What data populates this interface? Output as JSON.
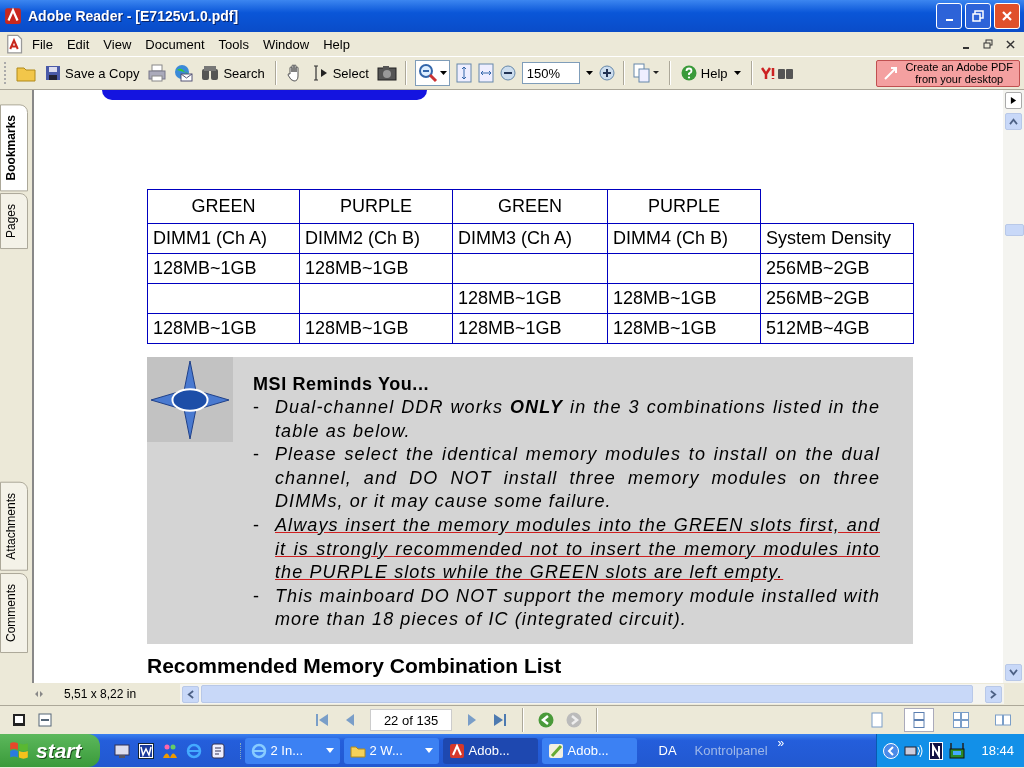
{
  "window": {
    "title": "Adobe Reader - [E7125v1.0.pdf]"
  },
  "menu": [
    "File",
    "Edit",
    "View",
    "Document",
    "Tools",
    "Window",
    "Help"
  ],
  "toolbar": {
    "save_label": "Save a Copy",
    "search_label": "Search",
    "select_label": "Select",
    "zoom": "150%",
    "help_label": "Help",
    "promo_lines": [
      "Create an Adobe PDF",
      "from your desktop"
    ]
  },
  "side_tabs": [
    {
      "label": "Bookmarks",
      "selected": true
    },
    {
      "label": "Pages",
      "selected": false
    },
    {
      "label": "Attachments",
      "selected": false
    },
    {
      "label": "Comments",
      "selected": false
    }
  ],
  "document": {
    "table": {
      "header": [
        "GREEN",
        "PURPLE",
        "GREEN",
        "PURPLE"
      ],
      "columns": [
        "DIMM1 (Ch A)",
        "DIMM2 (Ch B)",
        "DIMM3 (Ch A)",
        "DIMM4 (Ch B)",
        "System Density"
      ],
      "rows": [
        [
          "128MB~1GB",
          "128MB~1GB",
          "",
          "",
          "256MB~2GB"
        ],
        [
          "",
          "",
          "128MB~1GB",
          "128MB~1GB",
          "256MB~2GB"
        ],
        [
          "128MB~1GB",
          "128MB~1GB",
          "128MB~1GB",
          "128MB~1GB",
          "512MB~4GB"
        ]
      ]
    },
    "notice": {
      "title": "MSI Reminds You...",
      "bullets": [
        {
          "marker": "-",
          "text": "Dual-channel DDR works **ONLY** in the 3 combinations listed in the table as below.",
          "underlined": false
        },
        {
          "marker": "-",
          "text": "Please select the identical memory modules to install on the dual channel, and DO NOT install three memory modules on three DIMMs, or it may cause some failure.",
          "underlined": false
        },
        {
          "marker": "-",
          "text": "Always insert the memory modules into the GREEN slots first, and it is strongly recommended not to insert the memory modules into the PURPLE slots while the GREEN slots are left empty.",
          "underlined": true
        },
        {
          "marker": "-",
          "text": "This mainboard DO NOT support the memory module installed with more than 18 pieces of IC (integrated circuit).",
          "underlined": false
        }
      ]
    },
    "next_heading": "Recommended Memory Combination List"
  },
  "status": {
    "page_size": "5,51 x 8,22 in",
    "page": "22 of 135"
  },
  "view_modes": [
    {
      "kind": "single",
      "selected": false
    },
    {
      "kind": "continuous",
      "selected": true
    },
    {
      "kind": "facing",
      "selected": false
    },
    {
      "kind": "continuous-facing",
      "selected": false
    }
  ],
  "taskbar": {
    "start": "start",
    "tasks": [
      {
        "kind": "browser",
        "label": "2 In...",
        "selected": false,
        "menu": true
      },
      {
        "kind": "folder",
        "label": "2 W...",
        "selected": false,
        "menu": true
      },
      {
        "kind": "reader",
        "label": "Adob...",
        "selected": true,
        "menu": false
      },
      {
        "kind": "editor",
        "label": "Adob...",
        "selected": false,
        "menu": false
      }
    ],
    "language": "DA",
    "toolbar_label": "Kontrolpanel",
    "expander": "»",
    "clock": "18:44"
  }
}
